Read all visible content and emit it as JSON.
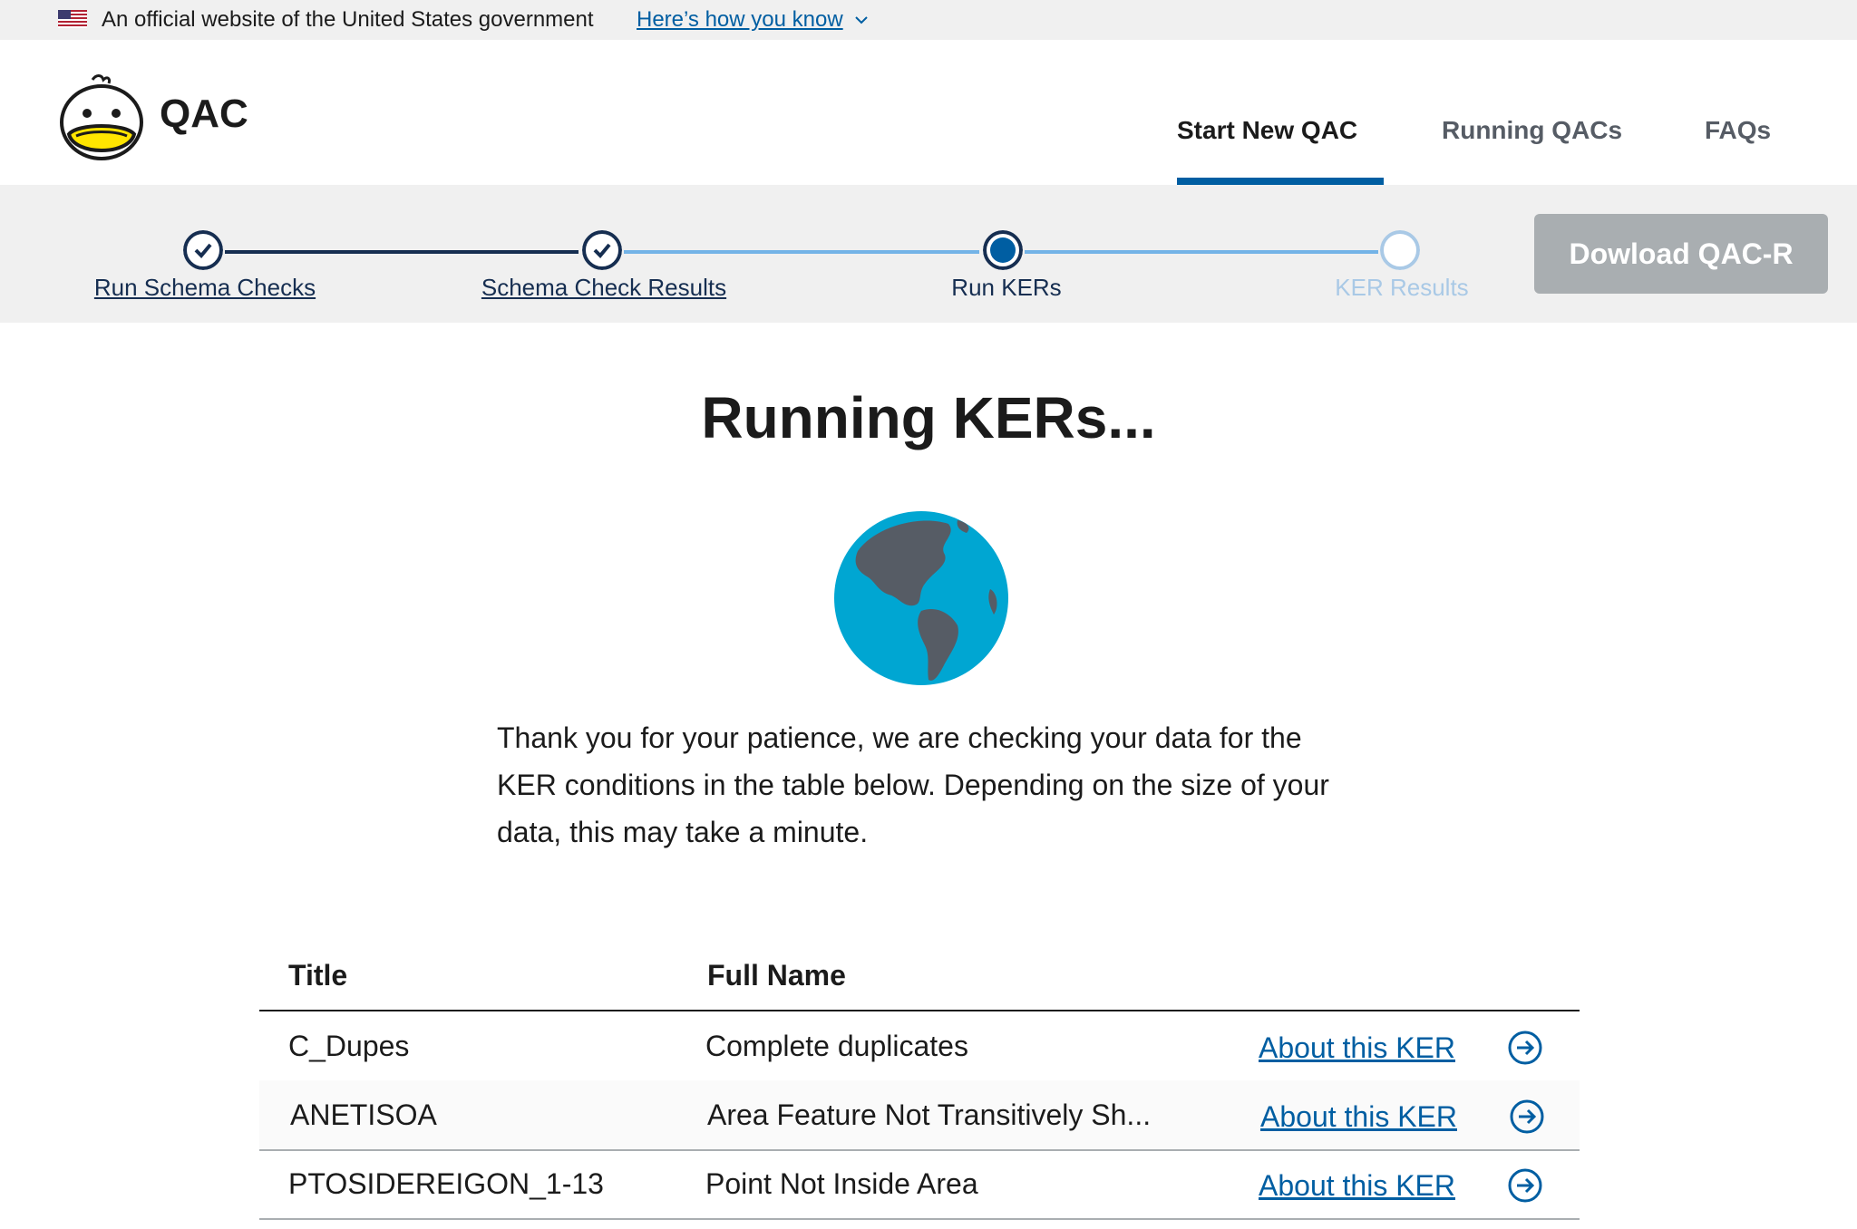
{
  "gov_banner": {
    "text": "An official website of the United States government",
    "link": "Here’s how you know"
  },
  "header": {
    "brand": "QAC",
    "nav": [
      {
        "label": "Start New QAC",
        "active": true
      },
      {
        "label": "Running QACs",
        "active": false
      },
      {
        "label": "FAQs",
        "active": false
      }
    ]
  },
  "steps": [
    {
      "label": "Run Schema Checks",
      "status": "complete"
    },
    {
      "label": "Schema Check Results",
      "status": "complete"
    },
    {
      "label": "Run KERs",
      "status": "current"
    },
    {
      "label": "KER Results",
      "status": "upcoming"
    }
  ],
  "download_button": {
    "label": "Dowload QAC-R",
    "enabled": false
  },
  "main": {
    "title": "Running KERs...",
    "message": "Thank you for your patience, we are checking your data for the KER conditions in the table below. Depending on the size of your data, this may take a minute."
  },
  "table": {
    "headers": {
      "title": "Title",
      "full_name": "Full Name"
    },
    "rows": [
      {
        "title": "C_Dupes",
        "full_name": "Complete duplicates",
        "link": "About this KER"
      },
      {
        "title": "ANETISOA",
        "full_name": "Area Feature Not Transitively Sh...",
        "link": "About this KER"
      },
      {
        "title": "PTOSIDEREIGON_1-13",
        "full_name": "Point Not Inside Area",
        "link": "About this KER"
      }
    ]
  },
  "colors": {
    "primary": "#005ea2",
    "primary_dark": "#162e51",
    "step_future": "#a9c9e6",
    "banner_bg": "#f0f0f0",
    "disabled_button": "#a9aeb1",
    "globe_ocean": "#00a6d2",
    "globe_land": "#565c65"
  },
  "icons": {
    "flag": "us-flag-icon",
    "chevron": "chevron-down-icon",
    "logo": "duck-logo-icon",
    "check": "check-icon",
    "globe": "globe-icon",
    "arrow": "arrow-right-circle-icon"
  }
}
